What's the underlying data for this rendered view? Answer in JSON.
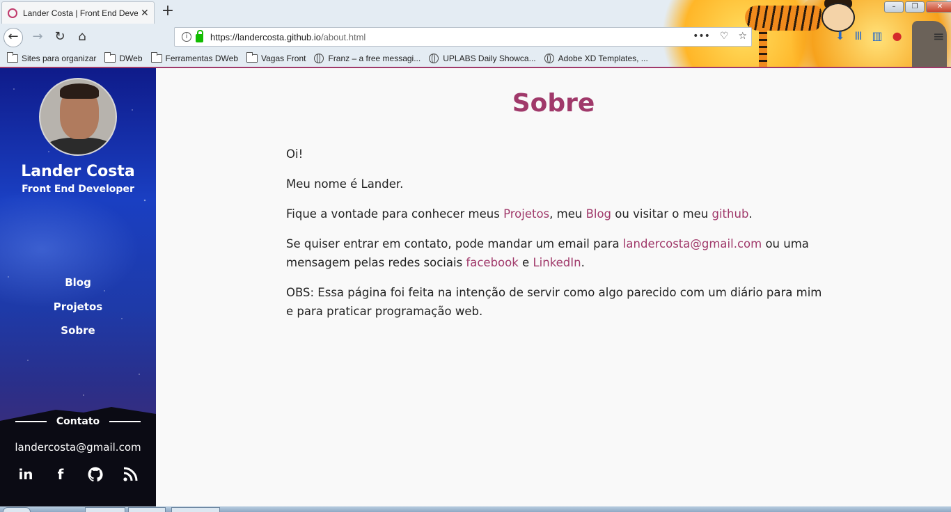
{
  "browser": {
    "tab_title": "Lander Costa | Front End Developer",
    "tab_close": "✕",
    "new_tab": "+",
    "url_host": "https://landercosta.github.io",
    "url_path": "/about.html",
    "url_actions": [
      "•••",
      "♡",
      "☆"
    ],
    "bookmarks": [
      {
        "label": "Sites para organizar",
        "icon": "folder-icon"
      },
      {
        "label": "DWeb",
        "icon": "folder-icon"
      },
      {
        "label": "Ferramentas DWeb",
        "icon": "folder-icon"
      },
      {
        "label": "Vagas Front",
        "icon": "folder-icon"
      },
      {
        "label": "Franz – a free messagi...",
        "icon": "globe-icon"
      },
      {
        "label": "UPLABS Daily Showca...",
        "icon": "globe-icon"
      },
      {
        "label": "Adobe XD Templates, ...",
        "icon": "globe-icon"
      }
    ],
    "accent": "#a0396a"
  },
  "sidebar": {
    "name": "Lander Costa",
    "role": "Front End Developer",
    "nav": [
      "Blog",
      "Projetos",
      "Sobre"
    ],
    "contact_label": "Contato",
    "email": "landercosta@gmail.com",
    "social": [
      "in",
      "f",
      "github-icon",
      "rss-icon"
    ]
  },
  "main": {
    "title": "Sobre",
    "p1": "Oi!",
    "p2": "Meu nome é Lander.",
    "p3": {
      "t1": "Fique a vontade para conhecer meus ",
      "link1": "Projetos",
      "t2": ", meu ",
      "link2": "Blog",
      "t3": " ou visitar o meu ",
      "link3": "github",
      "t4": "."
    },
    "p4": {
      "t1": "Se quiser entrar em contato, pode mandar um email para ",
      "link1": "landercosta@gmail.com",
      "t2": " ou uma mensagem pelas redes sociais ",
      "link2": "facebook",
      "t3": " e ",
      "link3": "LinkedIn",
      "t4": "."
    },
    "p5": "OBS: Essa página foi feita na intenção de servir como algo parecido com um diário para mim e para praticar programação web."
  }
}
